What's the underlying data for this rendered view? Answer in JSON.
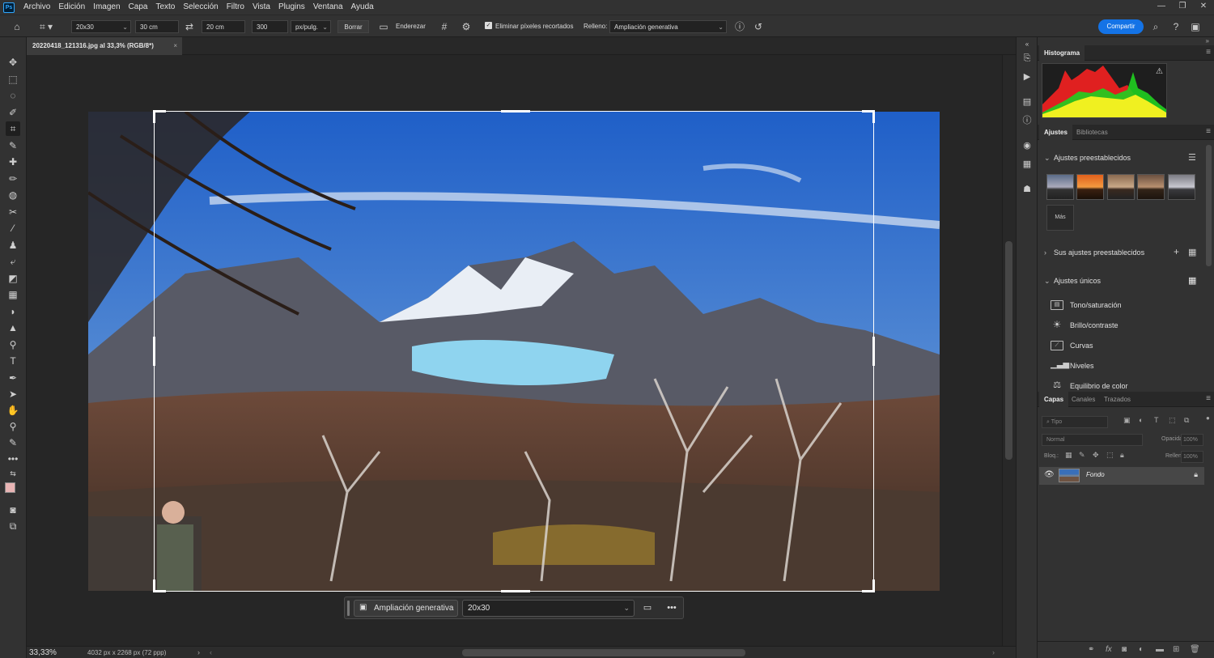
{
  "app": {
    "logo": "Ps"
  },
  "menu": [
    "Archivo",
    "Edición",
    "Imagen",
    "Capa",
    "Texto",
    "Selección",
    "Filtro",
    "Vista",
    "Plugins",
    "Ventana",
    "Ayuda"
  ],
  "window_controls": {
    "minimize": "—",
    "restore": "❐",
    "close": "✕"
  },
  "options": {
    "ratio_preset": "20x30",
    "width": "30 cm",
    "height": "20 cm",
    "resolution": "300",
    "resolution_unit": "px/pulg.",
    "clear_label": "Borrar",
    "straighten_label": "Enderezar",
    "delete_cropped_label": "Eliminar píxeles recortados",
    "delete_cropped_checked": true,
    "fill_label": "Relleno:",
    "fill_value": "Ampliación generativa",
    "share_label": "Compartir"
  },
  "document": {
    "tab_title": "20220418_121316.jpg al 33,3% (RGB/8*)",
    "close": "×"
  },
  "status": {
    "zoom": "33,33%",
    "dimensions": "4032 px x 2268 px (72 ppp)"
  },
  "taskbar": {
    "generative_label": "Ampliación generativa",
    "ratio_value": "20x30",
    "more": "•••"
  },
  "panels": {
    "histogram_tab": "Histograma",
    "adjust_tabs": [
      "Ajustes",
      "Bibliotecas"
    ],
    "presets_header": "Ajustes preestablecidos",
    "more_label": "Más",
    "your_presets_header": "Sus ajustes preestablecidos",
    "single_header": "Ajustes únicos",
    "adjustments": [
      "Tono/saturación",
      "Brillo/contraste",
      "Curvas",
      "Niveles",
      "Equilibrio de color"
    ],
    "layer_tabs": [
      "Capas",
      "Canales",
      "Trazados"
    ],
    "search_placeholder": "Tipo",
    "blend_mode": "Normal",
    "opacity_label": "Opacidad:",
    "opacity_value": "100%",
    "lock_label": "Bloq.:",
    "fill_label": "Relleno:",
    "fill_value": "100%",
    "layer_name": "Fondo"
  },
  "colors": {
    "accent": "#1473e6",
    "foreground": "#e8b4b4",
    "background": "#ffffff"
  }
}
